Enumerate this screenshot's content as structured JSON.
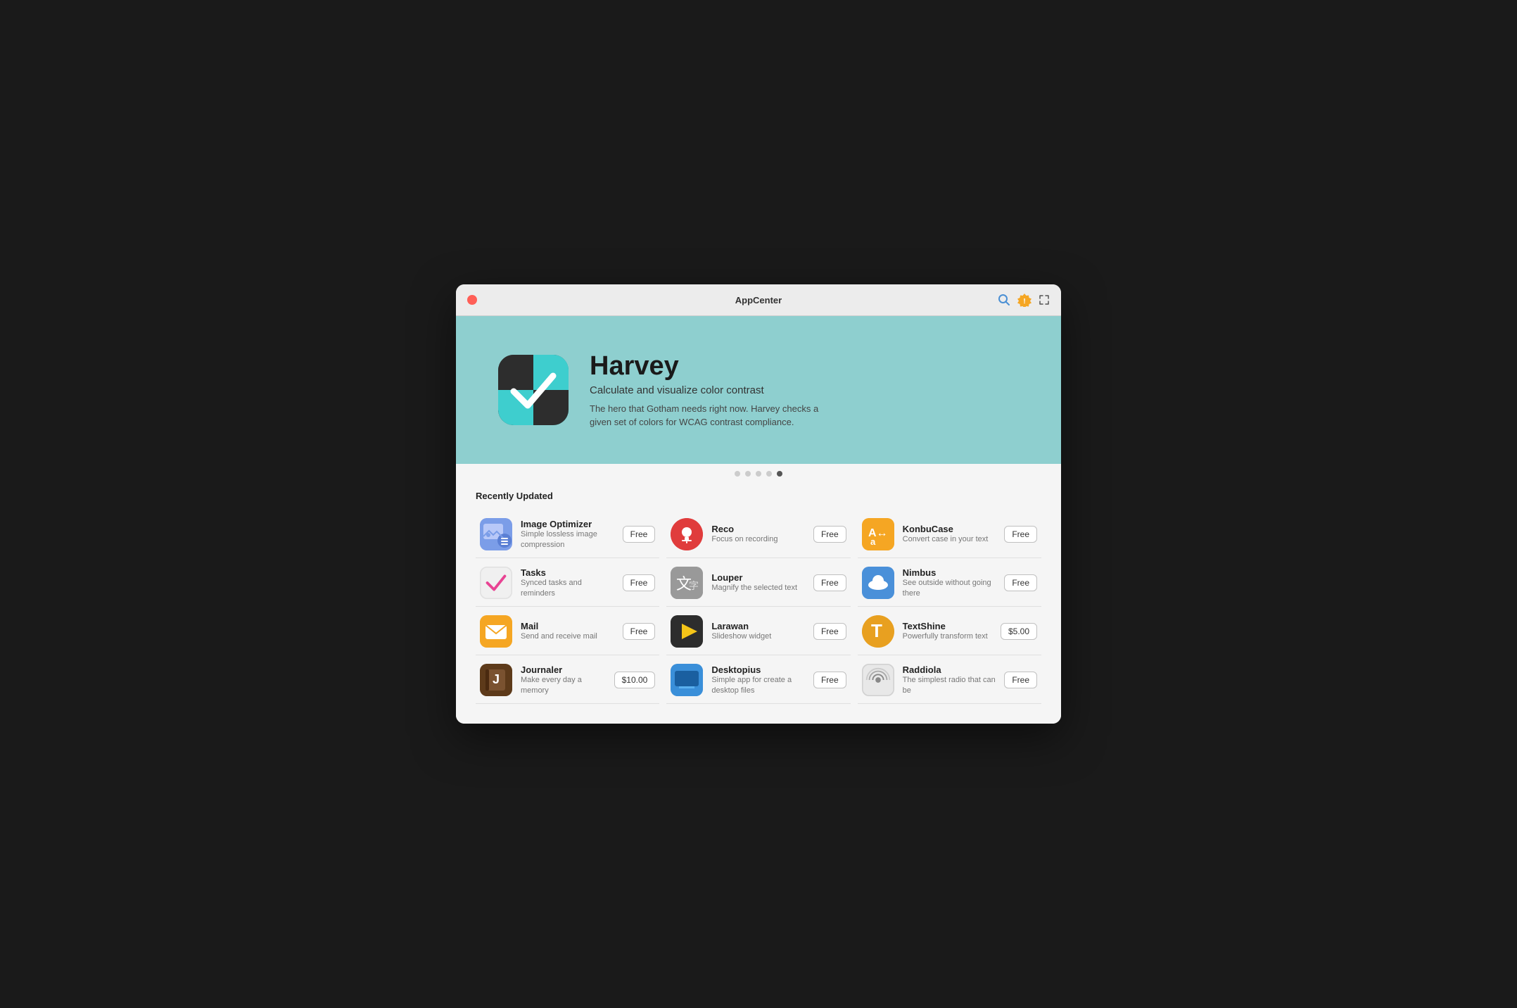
{
  "window": {
    "title": "AppCenter"
  },
  "hero": {
    "app_name": "Harvey",
    "subtitle": "Calculate and visualize color contrast",
    "description": "The hero that Gotham needs right now. Harvey checks a given set of colors for WCAG contrast compliance."
  },
  "dots": [
    {
      "active": false
    },
    {
      "active": false
    },
    {
      "active": false
    },
    {
      "active": false
    },
    {
      "active": true
    }
  ],
  "section_title": "Recently Updated",
  "apps": [
    {
      "name": "Image Optimizer",
      "desc": "Simple lossless image compression",
      "price": "Free",
      "icon_type": "image-optimizer"
    },
    {
      "name": "Reco",
      "desc": "Focus on recording",
      "price": "Free",
      "icon_type": "reco"
    },
    {
      "name": "KonbuCase",
      "desc": "Convert case in your text",
      "price": "Free",
      "icon_type": "konbucase"
    },
    {
      "name": "Tasks",
      "desc": "Synced tasks and reminders",
      "price": "Free",
      "icon_type": "tasks"
    },
    {
      "name": "Louper",
      "desc": "Magnify the selected text",
      "price": "Free",
      "icon_type": "louper"
    },
    {
      "name": "Nimbus",
      "desc": "See outside without going there",
      "price": "Free",
      "icon_type": "nimbus"
    },
    {
      "name": "Mail",
      "desc": "Send and receive mail",
      "price": "Free",
      "icon_type": "mail"
    },
    {
      "name": "Larawan",
      "desc": "Slideshow widget",
      "price": "Free",
      "icon_type": "larawan"
    },
    {
      "name": "TextShine",
      "desc": "Powerfully transform text",
      "price": "$5.00",
      "icon_type": "textshine"
    },
    {
      "name": "Journaler",
      "desc": "Make every day a memory",
      "price": "$10.00",
      "icon_type": "journaler"
    },
    {
      "name": "Desktopius",
      "desc": "Simple app for create a desktop files",
      "price": "Free",
      "icon_type": "desktopius"
    },
    {
      "name": "Raddiola",
      "desc": "The simplest radio that can be",
      "price": "Free",
      "icon_type": "raddiola"
    }
  ],
  "icons": {
    "search": "🔍",
    "badge": "⚙",
    "expand": "⛶",
    "close": "✕"
  }
}
